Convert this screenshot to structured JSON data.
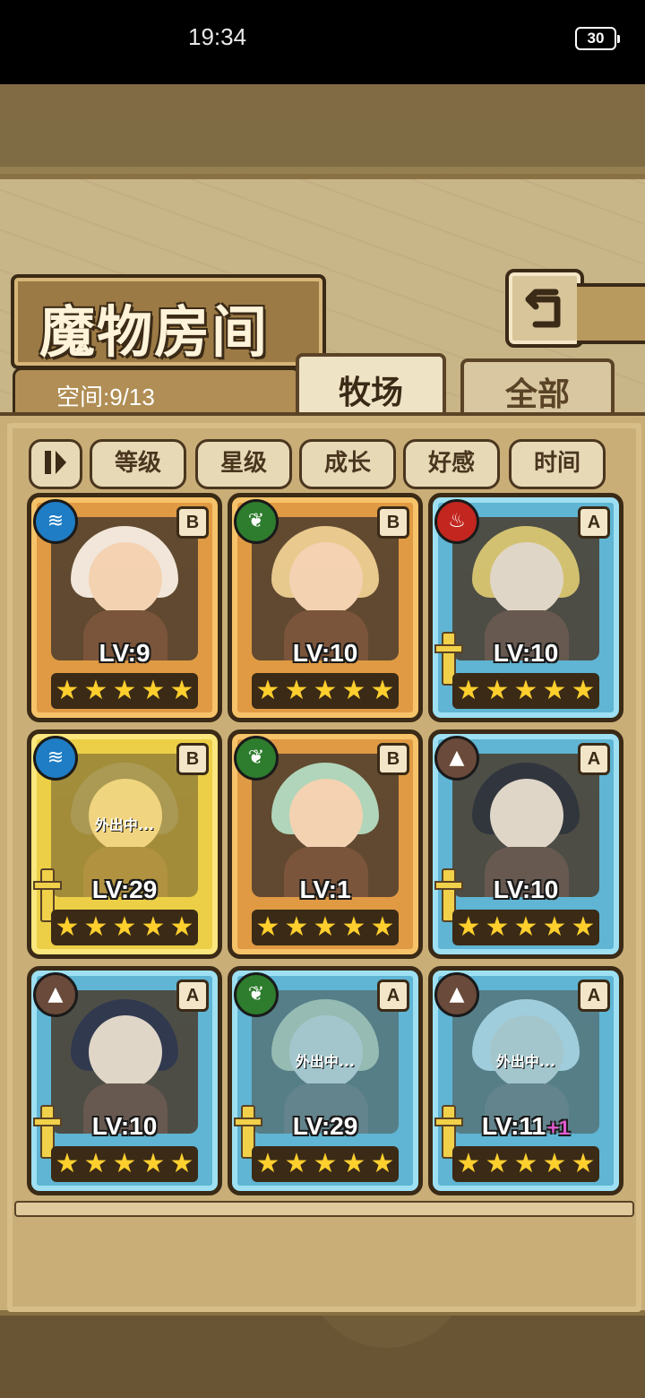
{
  "status": {
    "time": "19:34",
    "battery": "30"
  },
  "page": {
    "title": "魔物房间",
    "space": "空间:9/13",
    "tabs": [
      "牧场",
      "全部"
    ],
    "sort_buttons": [
      "等级",
      "星级",
      "成长",
      "好感",
      "时间"
    ]
  },
  "cards": [
    {
      "rank": "B",
      "element": "water-icon",
      "level": "LV:9",
      "stars": 5,
      "frame": "bronze",
      "away": ""
    },
    {
      "rank": "B",
      "element": "leaf-icon",
      "level": "LV:10",
      "stars": 5,
      "frame": "bronze",
      "away": ""
    },
    {
      "rank": "A",
      "element": "fire-icon",
      "level": "LV:10",
      "stars": 5,
      "frame": "blue",
      "away": ""
    },
    {
      "rank": "B",
      "element": "water-icon",
      "level": "LV:29",
      "stars": 5,
      "frame": "gold",
      "away": "外出中..."
    },
    {
      "rank": "B",
      "element": "leaf-icon",
      "level": "LV:1",
      "stars": 5,
      "frame": "bronze",
      "away": ""
    },
    {
      "rank": "A",
      "element": "mountain-icon",
      "level": "LV:10",
      "stars": 5,
      "frame": "blue",
      "away": ""
    },
    {
      "rank": "A",
      "element": "mountain-icon",
      "level": "LV:10",
      "stars": 5,
      "frame": "blue",
      "away": ""
    },
    {
      "rank": "A",
      "element": "leaf-icon",
      "level": "LV:29",
      "stars": 5,
      "frame": "blue",
      "away": "外出中..."
    },
    {
      "rank": "A",
      "element": "mountain-icon",
      "level": "LV:11",
      "bonus": "+1",
      "stars": 5,
      "frame": "blue",
      "away": "外出中..."
    }
  ]
}
